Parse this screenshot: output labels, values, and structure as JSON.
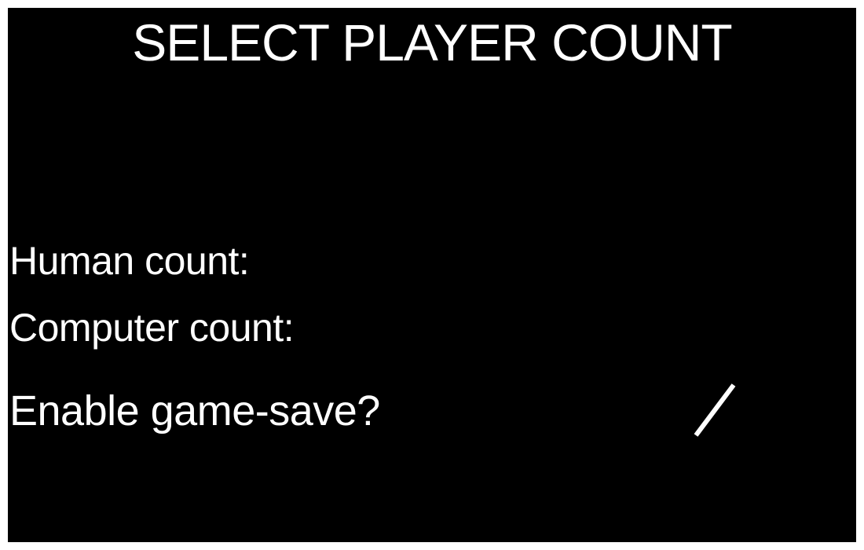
{
  "screen": {
    "title": "SELECT PLAYER COUNT",
    "background_color": "#000000",
    "text_color": "#ffffff"
  },
  "options": {
    "human_count": {
      "label": "Human count:"
    },
    "computer_count": {
      "label": "Computer count:"
    },
    "game_save": {
      "label": "Enable game-save?",
      "toggle_icon": "slash-icon"
    }
  }
}
